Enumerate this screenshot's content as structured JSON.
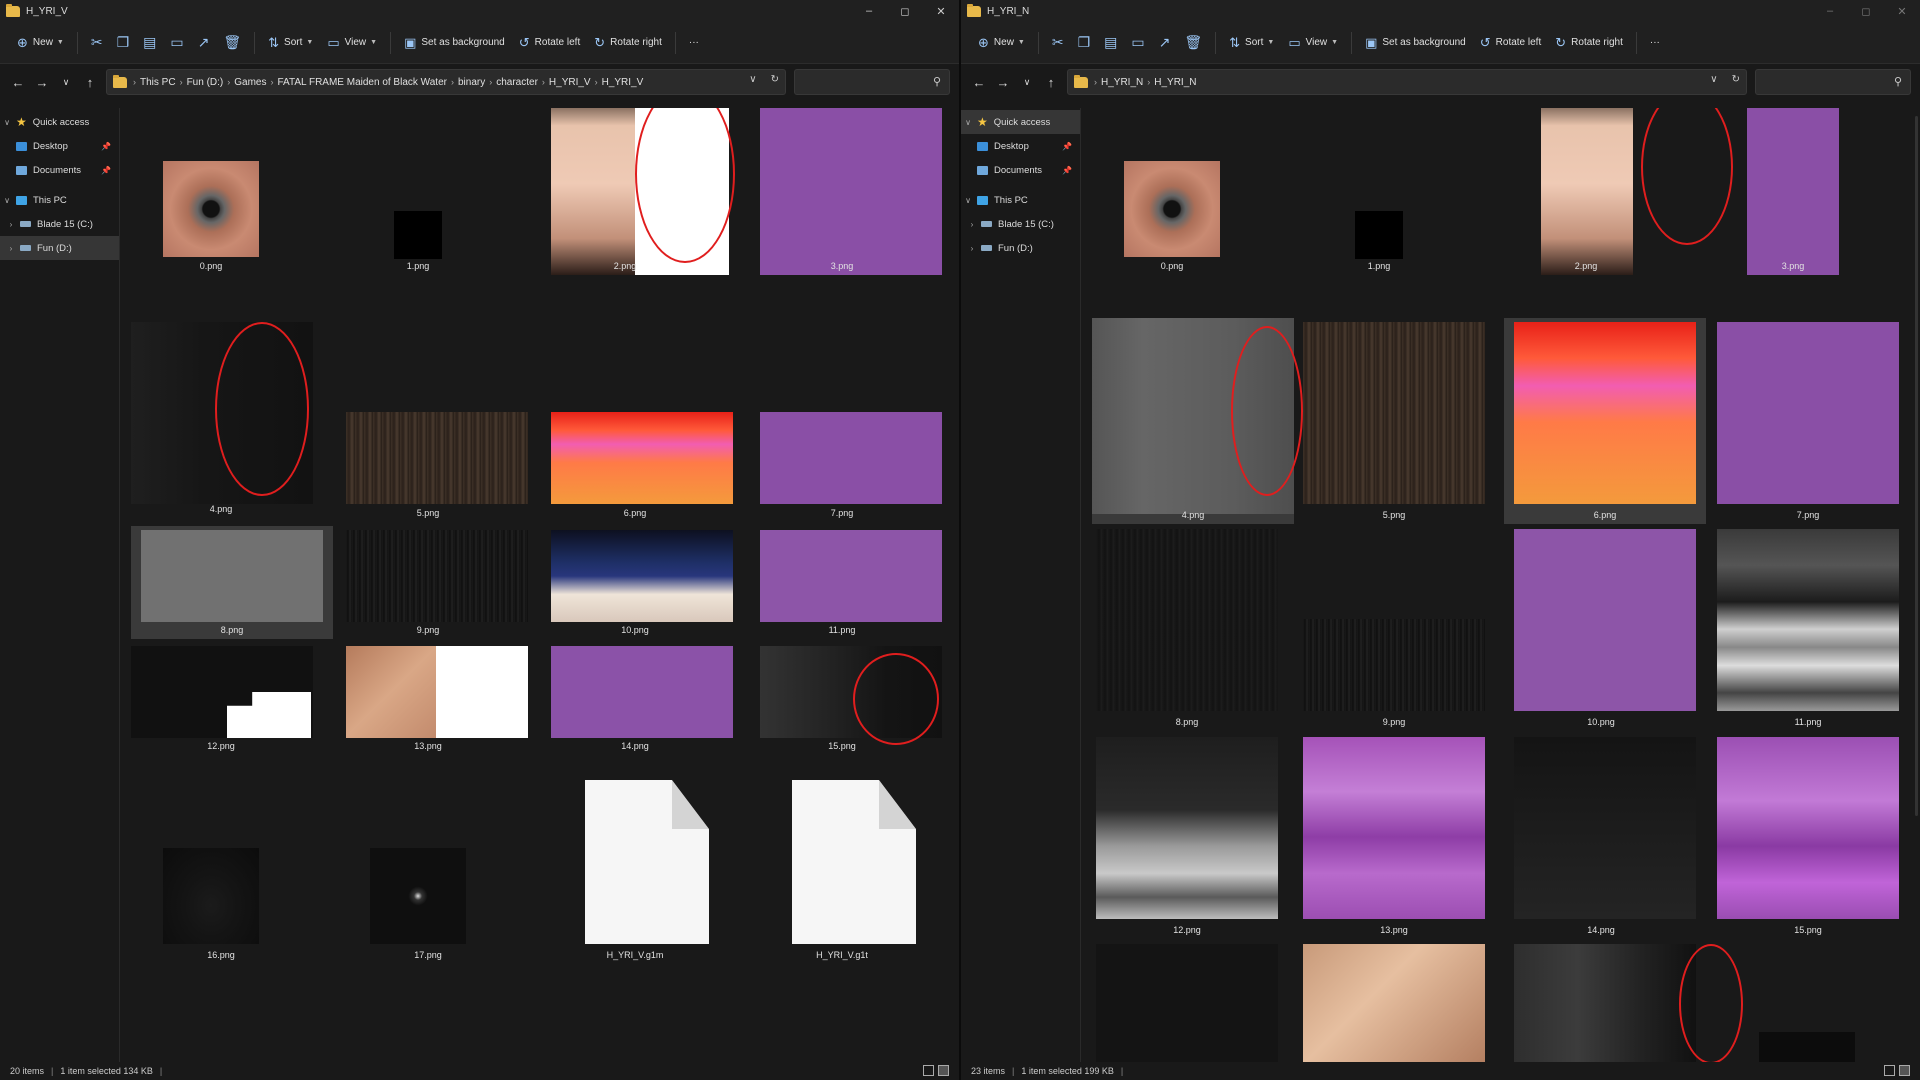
{
  "toolbar": {
    "new": "New",
    "sort": "Sort",
    "view": "View",
    "set_background": "Set as background",
    "rotate_left": "Rotate left",
    "rotate_right": "Rotate right",
    "more": "···"
  },
  "nav": {
    "quick_access": "Quick access",
    "desktop": "Desktop",
    "documents": "Documents",
    "this_pc": "This PC",
    "blade": "Blade 15 (C:)",
    "fun": "Fun (D:)"
  },
  "left": {
    "title": "H_YRI_V",
    "breadcrumb": [
      "This PC",
      "Fun (D:)",
      "Games",
      "FATAL FRAME Maiden of Black Water",
      "binary",
      "character",
      "H_YRI_V",
      "H_YRI_V"
    ],
    "files": [
      "0.png",
      "1.png",
      "2.png",
      "3.png",
      "4.png",
      "5.png",
      "6.png",
      "7.png",
      "8.png",
      "9.png",
      "10.png",
      "11.png",
      "12.png",
      "13.png",
      "14.png",
      "15.png",
      "16.png",
      "17.png",
      "H_YRI_V.g1m",
      "H_YRI_V.g1t"
    ],
    "status": {
      "items": "20 items",
      "selected": "1 item selected  134 KB"
    }
  },
  "right": {
    "title": "H_YRI_N",
    "breadcrumb": [
      "H_YRI_N",
      "H_YRI_N"
    ],
    "files": [
      "0.png",
      "1.png",
      "2.png",
      "3.png",
      "4.png",
      "5.png",
      "6.png",
      "7.png",
      "8.png",
      "9.png",
      "10.png",
      "11.png",
      "12.png",
      "13.png",
      "14.png",
      "15.png"
    ],
    "status": {
      "items": "23 items",
      "selected": "1 item selected  199 KB"
    }
  }
}
